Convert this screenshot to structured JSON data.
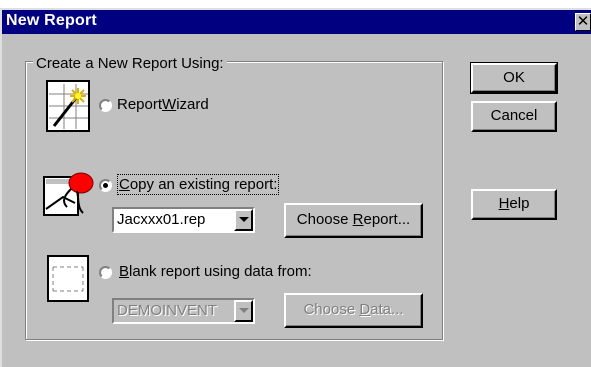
{
  "window": {
    "title": "New Report"
  },
  "group": {
    "label": "Create a New Report Using:"
  },
  "options": {
    "wizard": {
      "label_pre": "Report",
      "label_ul": "W",
      "label_post": "izard",
      "selected": false
    },
    "copy": {
      "label_ul": "C",
      "label_post": "opy an existing report:",
      "selected": true
    },
    "blank": {
      "label_ul": "B",
      "label_post": "lank report using data from:",
      "selected": false
    }
  },
  "copy_combo": {
    "value": "Jacxxx01.rep"
  },
  "choose_report": {
    "label_pre": "Choose ",
    "label_ul": "R",
    "label_post": "eport..."
  },
  "blank_combo": {
    "value": "DEMOINVENT"
  },
  "choose_data": {
    "label_pre": "Choose ",
    "label_ul": "D",
    "label_post": "ata..."
  },
  "buttons": {
    "ok": "OK",
    "cancel": "Cancel",
    "help_ul": "H",
    "help_post": "elp"
  },
  "close_glyph": "✕",
  "icons": {
    "wizard": "magic-wand-icon",
    "copy": "copy-report-icon",
    "blank": "blank-report-icon"
  }
}
